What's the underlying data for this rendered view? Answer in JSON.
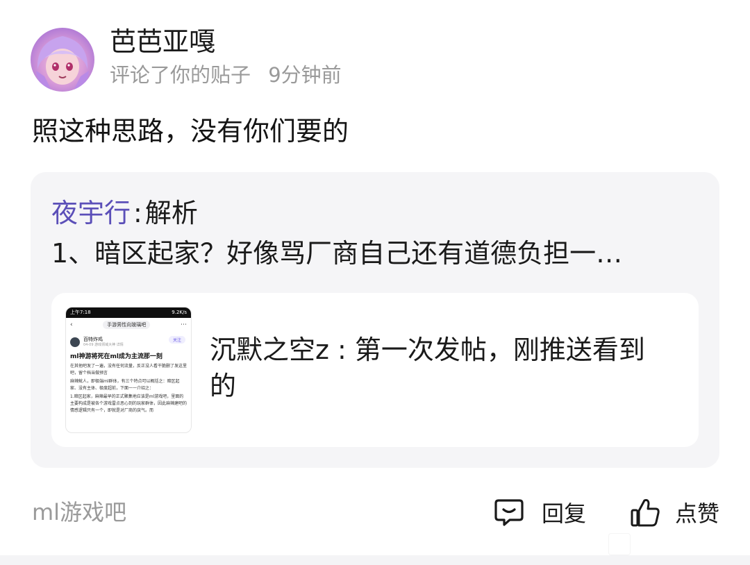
{
  "post": {
    "username": "芭芭亚嘎",
    "action": "评论了你的贴子",
    "time": "9分钟前",
    "comment": "照这种思路，没有你们要的"
  },
  "quote": {
    "author": "夜宇行",
    "separator": ":",
    "action": "解析",
    "body": "1、暗区起家？好像骂厂商自己还有道德负担一…",
    "inner": {
      "text": "沉默之空z : 第一次发帖，刚推送看到的",
      "thumbnail": {
        "status_time": "上午7:18",
        "status_right": "9.2K/s",
        "topic": "手游男性向玻璃吧",
        "author_name": "百特炸鸡",
        "author_meta": "04-09  游戏领域大神 详情",
        "follow": "关注",
        "title": "ml神游将死在ml成为主流那一刻",
        "paragraphs": [
          "在其他吧发了一遍，没有任何流量，反正没人看干脆删了发这里吧，留个档当做预言",
          "麻辣鱿人，即极端ml群体，有三个特点可以概括之：暗区起家、没有主体、极度超前，下面一一介绍之：",
          "1.暗区起家，麻辣最早的正式聚集地应该是ml游戏吧，里面的主要构成是被各个游戏雷点恶心到的玩家群体，因此麻辣建吧的情感逻辑只有一个，即就是对厂商的戾气。而"
        ]
      }
    }
  },
  "footer": {
    "forum": "ml游戏吧",
    "reply_label": "回复",
    "like_label": "点赞"
  }
}
